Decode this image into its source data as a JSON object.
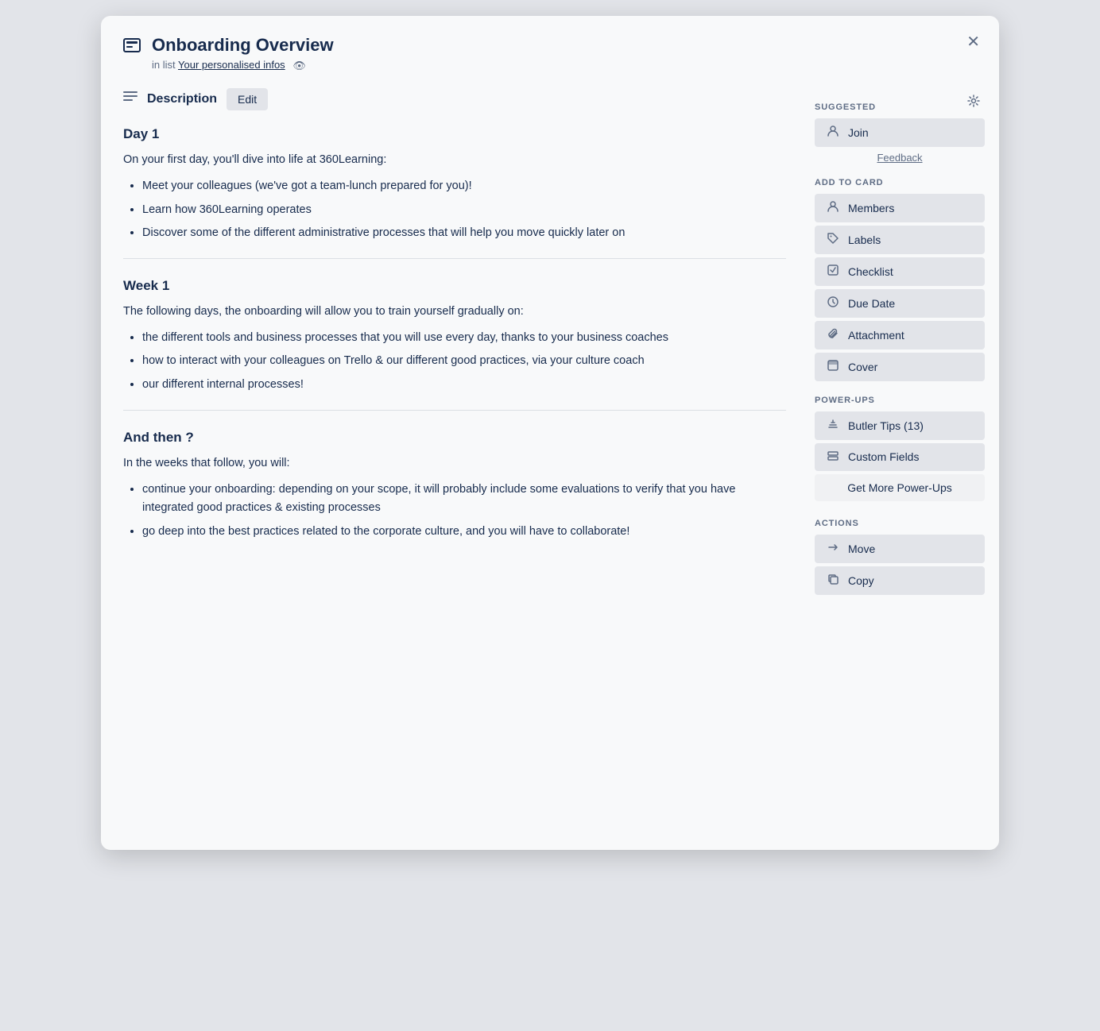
{
  "modal": {
    "title": "Onboarding Overview",
    "subtitle_prefix": "in list",
    "list_name": "Your personalised infos",
    "close_label": "✕"
  },
  "description": {
    "section_label": "Description",
    "edit_button": "Edit"
  },
  "content": {
    "day1": {
      "heading": "Day 1",
      "intro": "On your first day, you'll dive into life at 360Learning:",
      "bullets": [
        "Meet your colleagues (we've got a team-lunch prepared for you)!",
        "Learn how 360Learning operates",
        "Discover some of the different administrative processes that will help you move quickly later on"
      ]
    },
    "week1": {
      "heading": "Week 1",
      "intro": "The following days, the onboarding will allow you to train yourself gradually on:",
      "bullets": [
        "the different tools and business processes that you will use every day, thanks to your business coaches",
        "how to interact with your colleagues on Trello & our different good practices, via your culture coach",
        "our different internal processes!"
      ]
    },
    "andthen": {
      "heading": "And then ?",
      "intro": "In the weeks that follow, you will:",
      "bullets": [
        "continue your onboarding: depending on your scope, it will probably include some evaluations to verify that you have integrated good practices & existing processes",
        "go deep into the best practices related to the corporate culture, and you will have to collaborate!"
      ]
    }
  },
  "sidebar": {
    "suggested_label": "SUGGESTED",
    "join_label": "Join",
    "feedback_label": "Feedback",
    "add_to_card_label": "ADD TO CARD",
    "members_label": "Members",
    "labels_label": "Labels",
    "checklist_label": "Checklist",
    "due_date_label": "Due Date",
    "attachment_label": "Attachment",
    "cover_label": "Cover",
    "power_ups_label": "POWER-UPS",
    "butler_tips_label": "Butler Tips (13)",
    "custom_fields_label": "Custom Fields",
    "get_more_label": "Get More Power-Ups",
    "actions_label": "ACTIONS",
    "move_label": "Move",
    "copy_label": "Copy"
  }
}
